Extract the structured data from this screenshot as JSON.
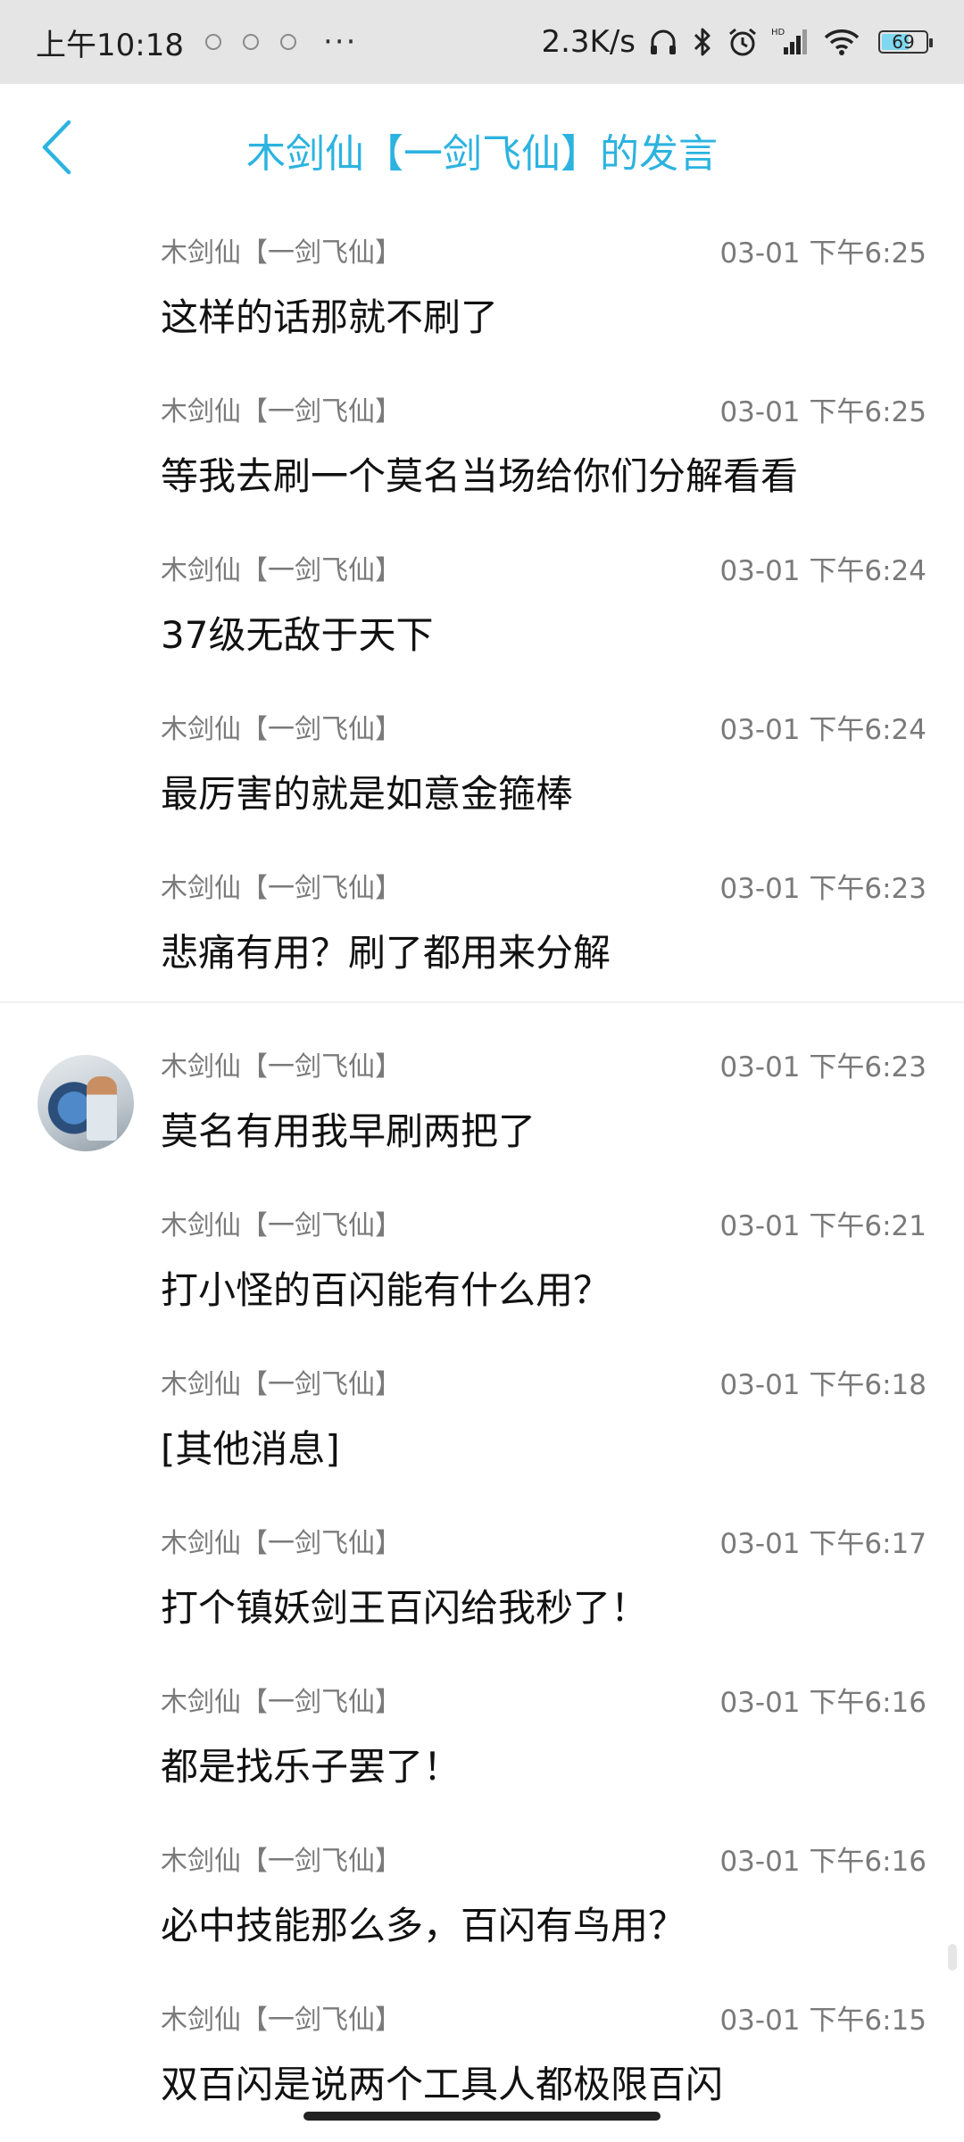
{
  "status_bar": {
    "time": "上午10:18",
    "more": "···",
    "net_speed": "2.3K/s",
    "battery": "69",
    "icons": [
      "notification-circle-icon",
      "registered-circle-icon",
      "clock-circle-icon",
      "headphones-icon",
      "bluetooth-icon",
      "alarm-icon",
      "hd-signal-icon",
      "wifi-icon"
    ]
  },
  "header": {
    "title": "木剑仙【一剑飞仙】的发言",
    "back_icon": "chevron-left-icon",
    "accent_color": "#2cb3e0"
  },
  "messages": [
    {
      "name": "木剑仙【一剑飞仙】",
      "time": "03-01 下午6:25",
      "text": "这样的话那就不刷了"
    },
    {
      "name": "木剑仙【一剑飞仙】",
      "time": "03-01 下午6:25",
      "text": "等我去刷一个莫名当场给你们分解看看"
    },
    {
      "name": "木剑仙【一剑飞仙】",
      "time": "03-01 下午6:24",
      "text": "37级无敌于天下"
    },
    {
      "name": "木剑仙【一剑飞仙】",
      "time": "03-01 下午6:24",
      "text": "最厉害的就是如意金箍棒"
    },
    {
      "name": "木剑仙【一剑飞仙】",
      "time": "03-01 下午6:23",
      "text": "悲痛有用？刷了都用来分解"
    },
    {
      "name": "木剑仙【一剑飞仙】",
      "time": "03-01 下午6:23",
      "text": "莫名有用我早刷两把了"
    },
    {
      "name": "木剑仙【一剑飞仙】",
      "time": "03-01 下午6:21",
      "text": "打小怪的百闪能有什么用？"
    },
    {
      "name": "木剑仙【一剑飞仙】",
      "time": "03-01 下午6:18",
      "text": "[其他消息]"
    },
    {
      "name": "木剑仙【一剑飞仙】",
      "time": "03-01 下午6:17",
      "text": "打个镇妖剑王百闪给我秒了！"
    },
    {
      "name": "木剑仙【一剑飞仙】",
      "time": "03-01 下午6:16",
      "text": "都是找乐子罢了！"
    },
    {
      "name": "木剑仙【一剑飞仙】",
      "time": "03-01 下午6:16",
      "text": "必中技能那么多，百闪有鸟用？"
    },
    {
      "name": "木剑仙【一剑飞仙】",
      "time": "03-01 下午6:15",
      "text": "双百闪是说两个工具人都极限百闪"
    }
  ]
}
